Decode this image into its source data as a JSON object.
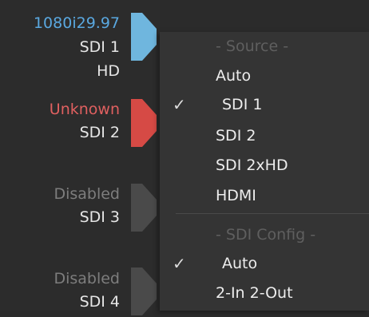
{
  "inputs": [
    {
      "status": "1080i29.97",
      "status_color": "#5aa8e0",
      "port": "SDI 1",
      "format": "HD",
      "arrow_color": "#6fb6de"
    },
    {
      "status": "Unknown",
      "status_color": "#e06060",
      "port": "SDI 2",
      "format": "",
      "arrow_color": "#d64a45"
    },
    {
      "status": "Disabled",
      "status_color": "#7d7d7d",
      "port": "SDI 3",
      "format": "",
      "arrow_color": "#4a4a4a"
    },
    {
      "status": "Disabled",
      "status_color": "#7d7d7d",
      "port": "SDI 4",
      "format": "",
      "arrow_color": "#4a4a4a"
    }
  ],
  "menu": {
    "source_heading": "- Source -",
    "source_items": [
      {
        "label": "Auto",
        "checked": false
      },
      {
        "label": "SDI 1",
        "checked": true
      },
      {
        "label": "SDI 2",
        "checked": false
      },
      {
        "label": "SDI 2xHD",
        "checked": false
      },
      {
        "label": "HDMI",
        "checked": false
      }
    ],
    "config_heading": "- SDI Config -",
    "config_items": [
      {
        "label": "Auto",
        "checked": true
      },
      {
        "label": "2-In 2-Out",
        "checked": false
      }
    ],
    "check_glyph": "✓"
  }
}
